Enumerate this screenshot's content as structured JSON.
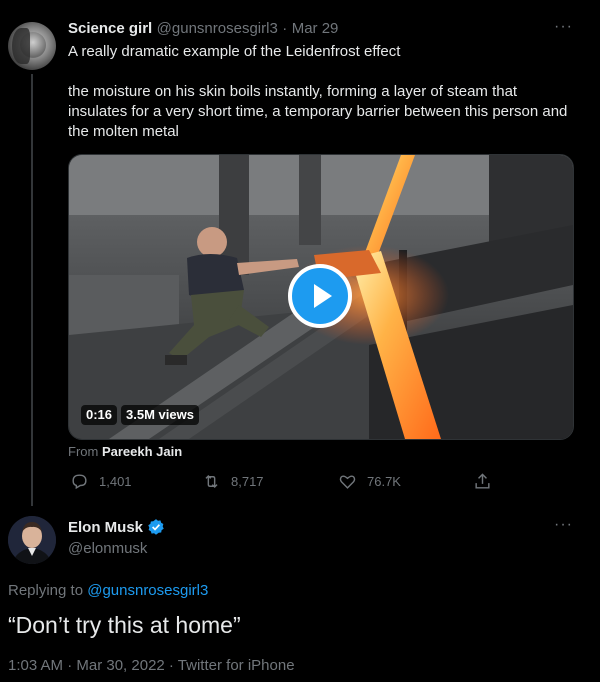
{
  "tweet": {
    "author_name": "Science girl",
    "author_handle": "@gunsnrosesgirl3",
    "date": "Mar 29",
    "separator": "·",
    "text_line1": "A really dramatic example of the Leidenfrost effect",
    "text_line2": "the moisture on his skin boils instantly, forming a layer of steam that insulates for a very short time, a temporary barrier between this person and the molten metal",
    "video": {
      "duration": "0:16",
      "views": "3.5M views",
      "from_label": "From",
      "from_name": "Pareekh Jain"
    },
    "actions": {
      "replies": "1,401",
      "retweets": "8,717",
      "likes": "76.7K"
    },
    "more_icon": "more-dots-icon"
  },
  "reply": {
    "author_name": "Elon Musk",
    "author_handle": "@elonmusk",
    "verified": true,
    "replying_label": "Replying to",
    "replying_to": "@gunsnrosesgirl3",
    "text": "“Don’t try this at home”",
    "timestamp": "1:03 AM · Mar 30, 2022 · Twitter for iPhone"
  },
  "colors": {
    "background": "#000000",
    "text": "#e7e9ea",
    "muted": "#71767b",
    "accent": "#1d9bf0",
    "play_button": "#1d9bf0"
  }
}
